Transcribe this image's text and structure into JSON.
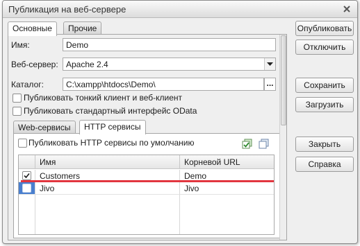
{
  "window": {
    "title": "Публикация на веб-сервере"
  },
  "tabs": [
    {
      "label": "Основные"
    },
    {
      "label": "Прочие"
    }
  ],
  "form": {
    "name_label": "Имя:",
    "name_value": "Demo",
    "server_label": "Веб-сервер:",
    "server_value": "Apache 2.4",
    "catalog_label": "Каталог:",
    "catalog_value": "C:\\xampp\\htdocs\\Demo\\",
    "browse_label": "...",
    "publish_thin_client_label": "Публиковать тонкий клиент и веб-клиент",
    "publish_thin_client_checked": false,
    "publish_odata_label": "Публиковать стандартный интерфейс OData",
    "publish_odata_checked": false
  },
  "inner_tabs": [
    {
      "label": "Web-сервисы"
    },
    {
      "label": "HTTP сервисы"
    }
  ],
  "http_services": {
    "default_publish_label": "Публиковать HTTP сервисы по умолчанию",
    "default_publish_checked": false,
    "icons": [
      "check-all-icon",
      "uncheck-all-icon"
    ],
    "columns": [
      "Имя",
      "Корневой URL"
    ],
    "rows": [
      {
        "checked": true,
        "name": "Customers",
        "url": "Demo"
      },
      {
        "checked": false,
        "name": "Jivo",
        "url": "Jivo"
      }
    ]
  },
  "buttons": {
    "publish": "Опубликовать",
    "disable": "Отключить",
    "save": "Сохранить",
    "load": "Загрузить",
    "close": "Закрыть",
    "help": "Справка"
  },
  "colors": {
    "annotation_line": "#e2363f",
    "selected_row": "#4a7fce"
  }
}
